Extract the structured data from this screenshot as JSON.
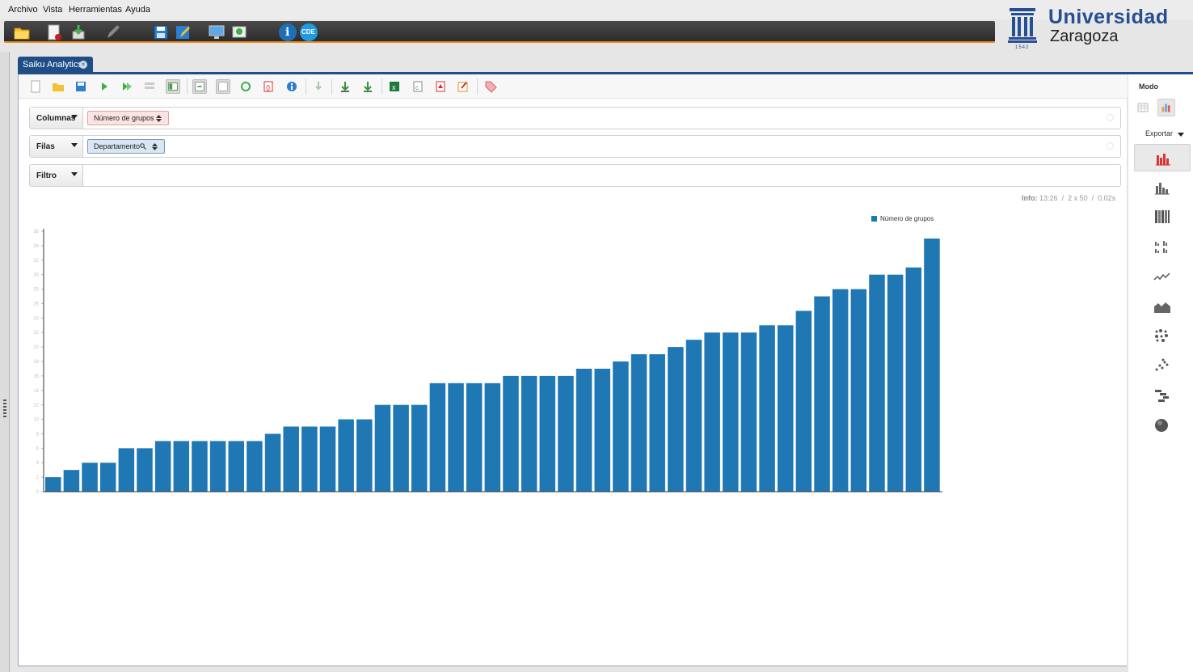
{
  "menu": [
    "Archivo",
    "Vista",
    "Herramientas",
    "Ayuda"
  ],
  "logo": {
    "line1": "Universidad",
    "line2": "Zaragoza",
    "year": "1542"
  },
  "toolbar": {
    "cde_label": "CDE",
    "info_label": "i"
  },
  "tab": {
    "label": "Saiku Analytics",
    "close": "×"
  },
  "axes": {
    "columns": {
      "label": "Columnas",
      "chip": "Número de grupos"
    },
    "rows": {
      "label": "Filas",
      "chip": "Departamento"
    },
    "filter": {
      "label": "Filtro"
    }
  },
  "info": {
    "label": "Info:",
    "time": "13:26",
    "dims": "2 x 50",
    "elapsed": "0.02s"
  },
  "right_panel": {
    "mode_label": "Modo",
    "export_label": "Exportar"
  },
  "colors": {
    "accent": "#1f4e86",
    "bar": "#1f77b4",
    "toolbar_orange": "#e48b20"
  },
  "chart_data": {
    "type": "bar",
    "legend_position": "top-right",
    "grid": false,
    "ylim": [
      0,
      36
    ],
    "yticks": [
      0,
      2,
      4,
      6,
      8,
      10,
      12,
      14,
      16,
      18,
      20,
      22,
      24,
      26,
      28,
      30,
      32,
      34,
      36
    ],
    "series": [
      {
        "name": "Número de grupos",
        "color": "#1f77b4",
        "values": [
          2,
          3,
          4,
          4,
          6,
          6,
          7,
          7,
          7,
          7,
          7,
          7,
          8,
          9,
          9,
          9,
          10,
          10,
          12,
          12,
          12,
          15,
          15,
          15,
          15,
          16,
          16,
          16,
          16,
          17,
          17,
          18,
          19,
          19,
          20,
          21,
          22,
          22,
          22,
          23,
          23,
          25,
          27,
          28,
          28,
          30,
          30,
          31,
          35
        ]
      }
    ]
  }
}
